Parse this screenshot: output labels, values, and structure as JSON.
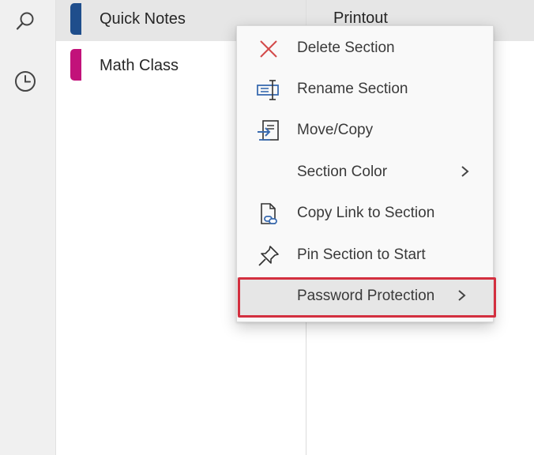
{
  "sections": [
    {
      "label": "Quick Notes",
      "color": "#1f4e8c",
      "active": true
    },
    {
      "label": "Math Class",
      "color": "#c2127a",
      "active": false
    }
  ],
  "pages": {
    "first_page": "Printout"
  },
  "sidebar": {
    "icons": [
      "search-icon",
      "recent-clock-icon"
    ]
  },
  "context_menu": {
    "items": [
      {
        "label": "Delete Section",
        "icon": "x-icon",
        "submenu": false
      },
      {
        "label": "Rename Section",
        "icon": "rename-icon",
        "submenu": false
      },
      {
        "label": "Move/Copy",
        "icon": "move-copy-icon",
        "submenu": false
      },
      {
        "label": "Section Color",
        "icon": "",
        "submenu": true
      },
      {
        "label": "Copy Link to Section",
        "icon": "link-icon",
        "submenu": false
      },
      {
        "label": "Pin Section to Start",
        "icon": "pin-icon",
        "submenu": false
      },
      {
        "label": "Password Protection",
        "icon": "",
        "submenu": true,
        "highlighted": true
      }
    ]
  },
  "colors": {
    "accent_red": "#d32f3f",
    "icon_blue": "#3a6bb0",
    "delete_red": "#d34a4a"
  }
}
